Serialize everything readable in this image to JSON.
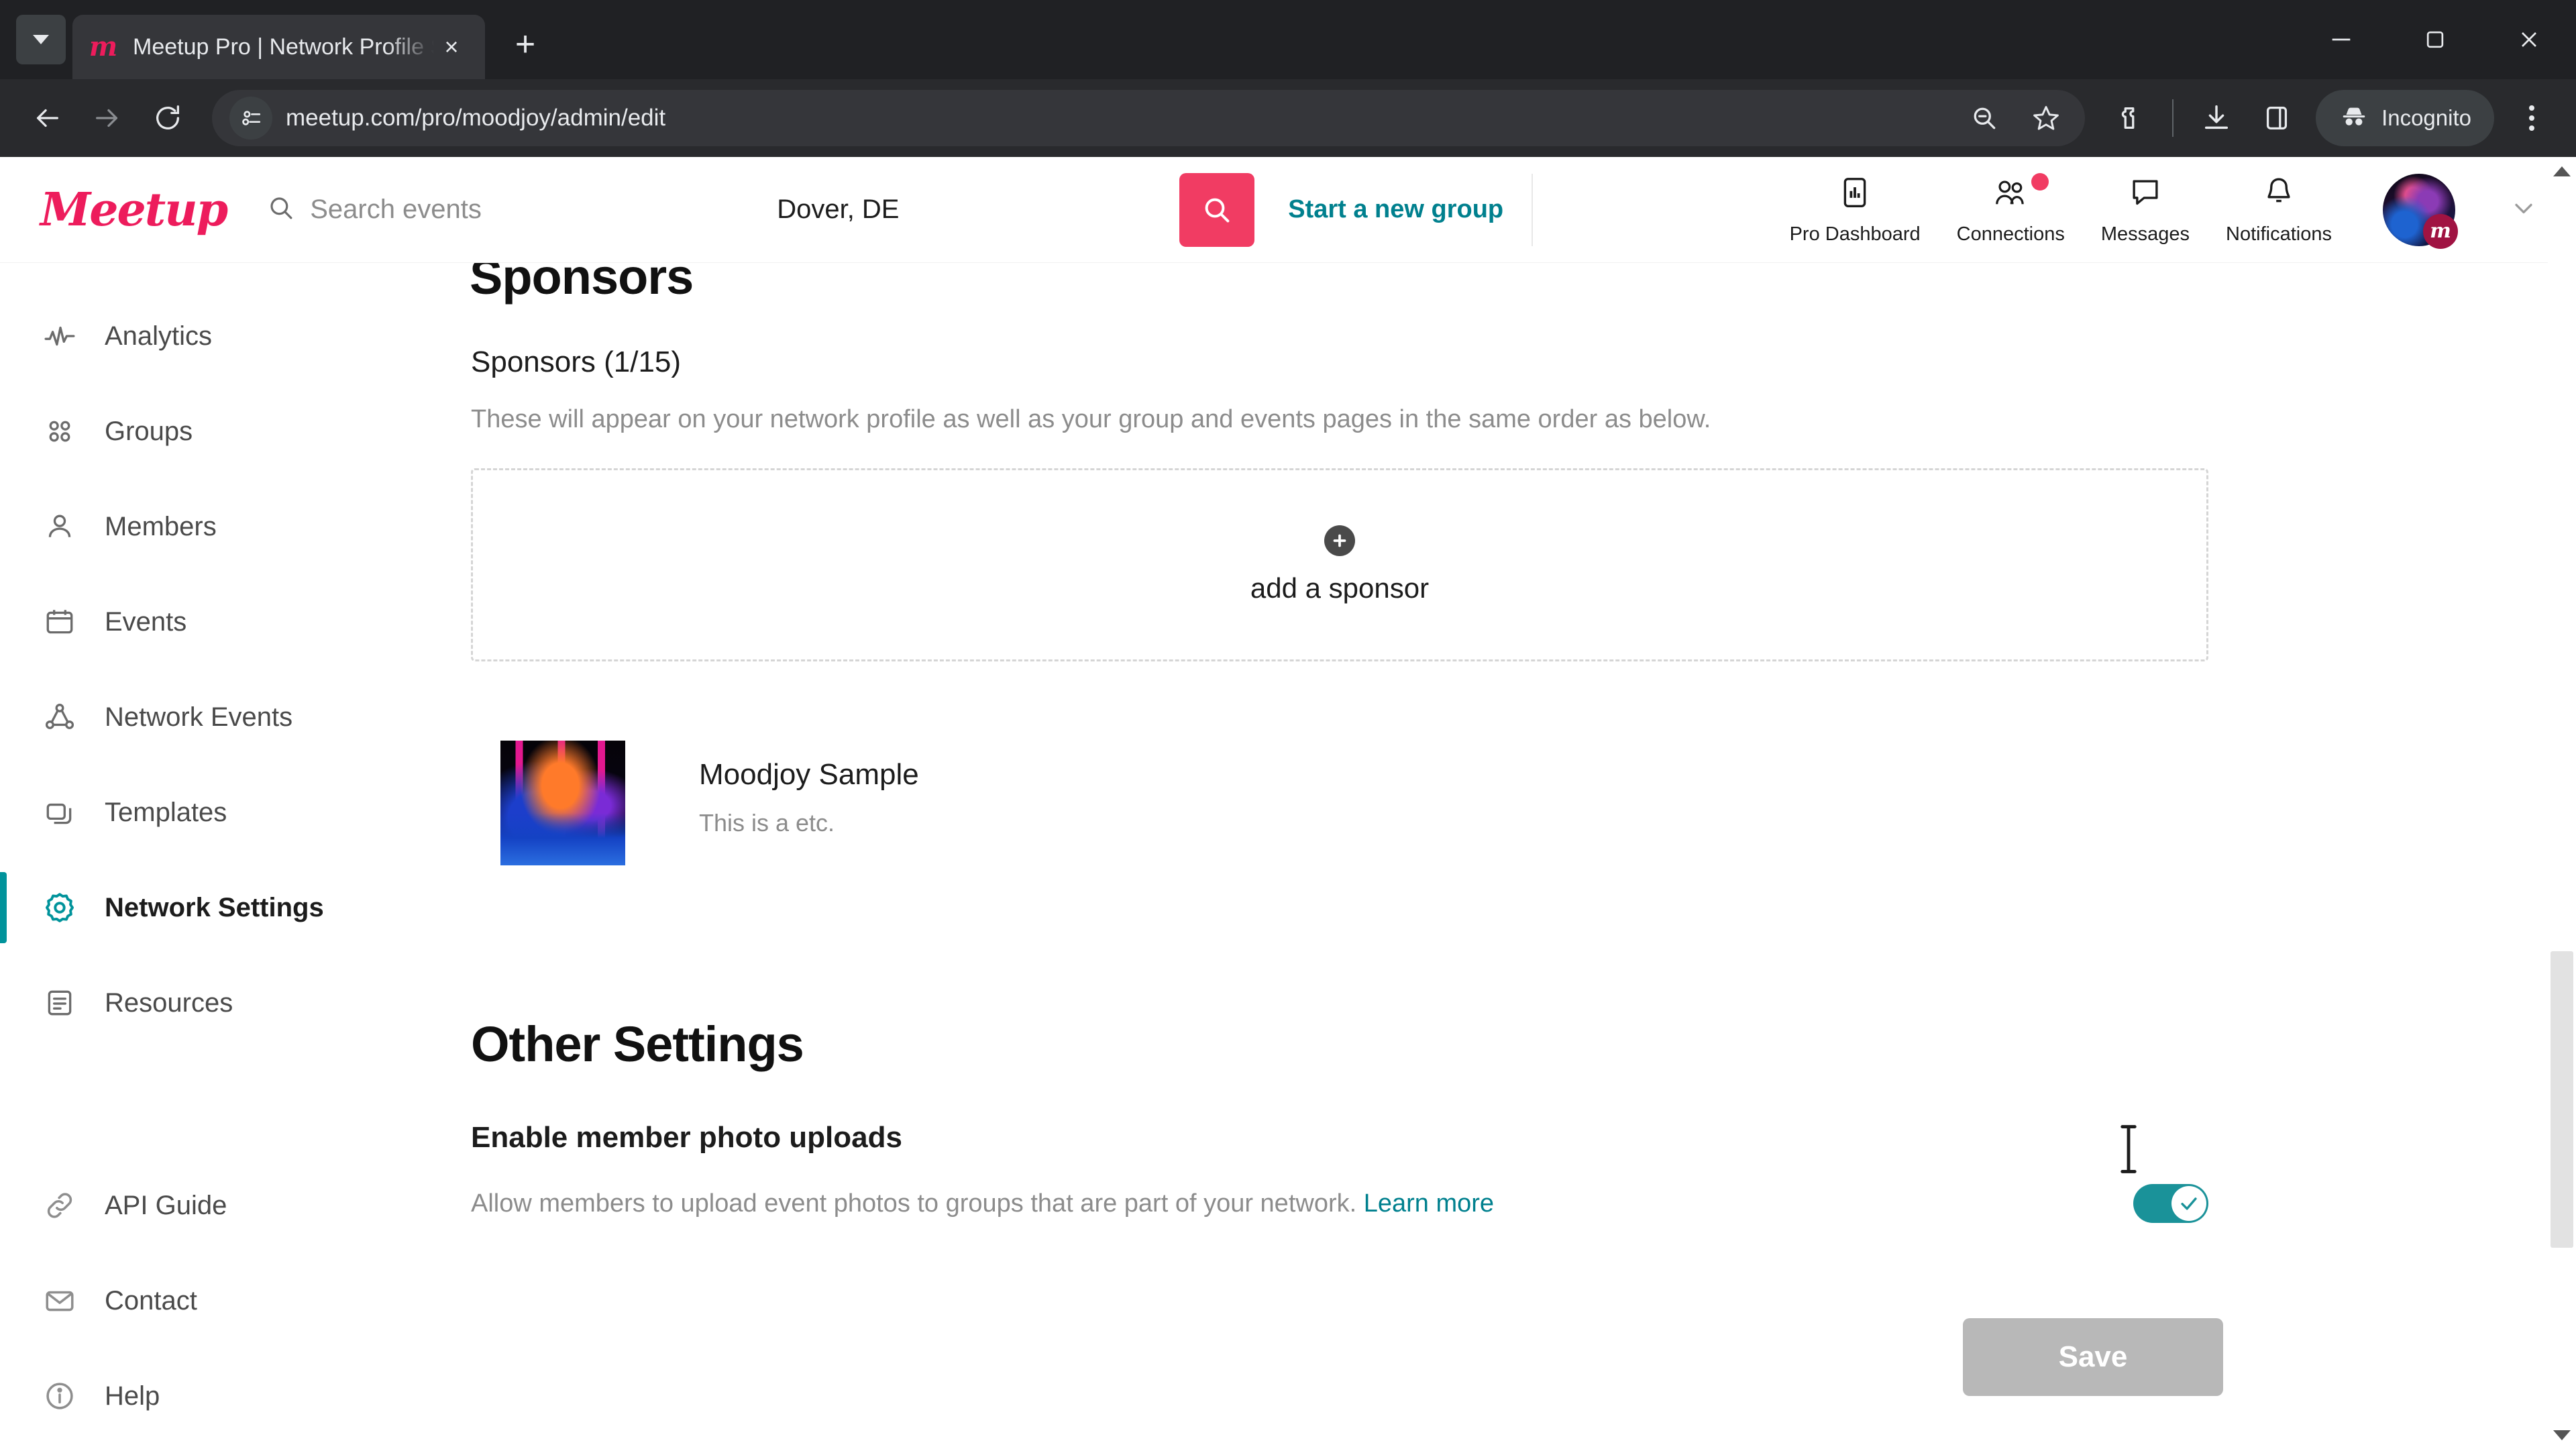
{
  "browser": {
    "tab": {
      "title": "Meetup Pro | Network Profile S",
      "favicon": "meetup-logo-icon",
      "close": "×",
      "new_tab": "+"
    },
    "tab_list_button": "chevron-down-icon",
    "window": {
      "minimize": "−",
      "maximize": "□",
      "close": "✕"
    },
    "toolbar": {
      "back": "back-arrow-icon",
      "forward": "forward-arrow-icon",
      "reload": "reload-icon",
      "site_info": "site-settings-icon",
      "url": "meetup.com/pro/moodjoy/admin/edit",
      "search_page": "search-icon",
      "bookmark": "star-icon",
      "extensions": "extensions-icon",
      "download": "download-icon",
      "side_panel": "side-panel-icon",
      "incognito_label": "Incognito",
      "incognito_icon": "incognito-hat-icon",
      "menu": "three-dot-menu-icon"
    }
  },
  "header": {
    "logo": "Meetup",
    "search_placeholder": "Search events",
    "search_icon": "search-icon",
    "location_value": "Dover, DE",
    "search_button_icon": "search-icon",
    "start_group": "Start a new group",
    "nav": [
      {
        "label": "Pro Dashboard",
        "icon": "chart-bar-icon",
        "badge": false
      },
      {
        "label": "Connections",
        "icon": "people-icon",
        "badge": true
      },
      {
        "label": "Messages",
        "icon": "chat-bubble-icon",
        "badge": false
      },
      {
        "label": "Notifications",
        "icon": "bell-icon",
        "badge": false
      }
    ],
    "avatar": "user-avatar",
    "avatar_badge": "m",
    "profile_chevron": "chevron-down-icon"
  },
  "sidebar": {
    "items": [
      {
        "label": "Analytics",
        "icon": "pulse-icon",
        "active": false
      },
      {
        "label": "Groups",
        "icon": "grid-dots-icon",
        "active": false
      },
      {
        "label": "Members",
        "icon": "person-icon",
        "active": false
      },
      {
        "label": "Events",
        "icon": "calendar-icon",
        "active": false
      },
      {
        "label": "Network Events",
        "icon": "network-icon",
        "active": false
      },
      {
        "label": "Templates",
        "icon": "windows-icon",
        "active": false
      },
      {
        "label": "Network Settings",
        "icon": "gear-icon",
        "active": true
      },
      {
        "label": "Resources",
        "icon": "document-icon",
        "active": false
      }
    ],
    "footer_items": [
      {
        "label": "API Guide",
        "icon": "link-icon"
      },
      {
        "label": "Contact",
        "icon": "envelope-icon"
      },
      {
        "label": "Help",
        "icon": "info-circle-icon"
      }
    ]
  },
  "main": {
    "sponsors": {
      "heading": "Sponsors",
      "count_label": "Sponsors (1/15)",
      "description": "These will appear on your network profile as well as your group and events pages in the same order as below.",
      "add_box": {
        "icon": "plus-circle-icon",
        "label": "add a sponsor"
      },
      "list": [
        {
          "name": "Moodjoy Sample",
          "description": "This is a etc.",
          "thumbnail": "sponsor-thumbnail"
        }
      ]
    },
    "other_settings": {
      "heading": "Other Settings",
      "setting_title": "Enable member photo uploads",
      "setting_description": "Allow members to upload event photos to groups that are part of your network.",
      "learn_more": "Learn more",
      "toggle_state": "on",
      "toggle_icon": "check-icon"
    },
    "save_label": "Save"
  },
  "colors": {
    "brand_red": "#f13c63",
    "brand_teal": "#00808e",
    "toggle_teal": "#1a9299",
    "chrome_dark": "#292a2d",
    "save_disabled": "#b8b8b8"
  },
  "scrollbar": {
    "up": "scroll-up-arrow",
    "down": "scroll-down-arrow"
  }
}
